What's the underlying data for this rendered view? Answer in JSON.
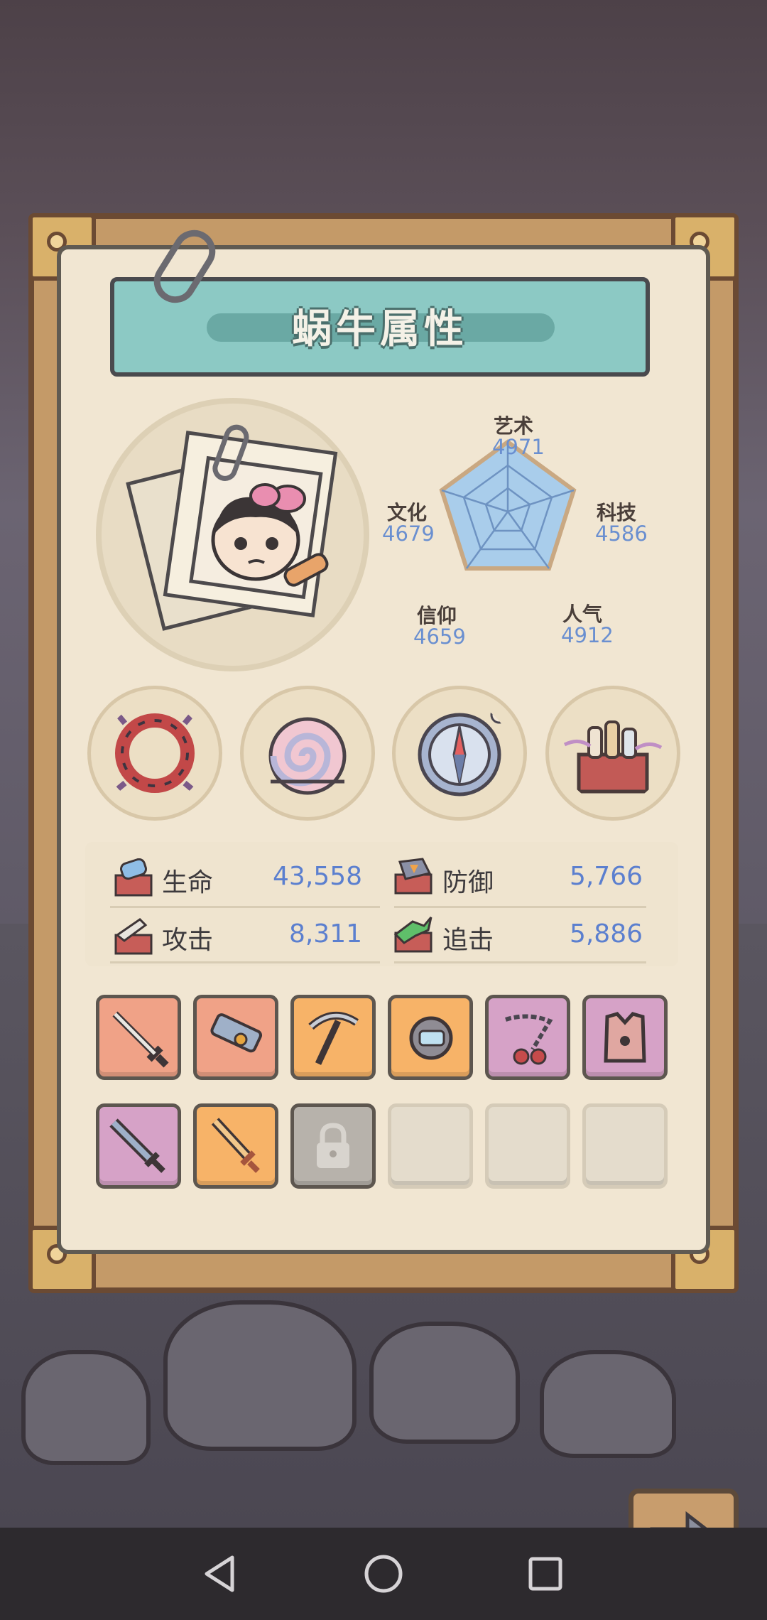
{
  "title": "蜗牛属性",
  "radar": {
    "stats": [
      {
        "name": "艺术",
        "value": "4971"
      },
      {
        "name": "科技",
        "value": "4586"
      },
      {
        "name": "人气",
        "value": "4912"
      },
      {
        "name": "信仰",
        "value": "4659"
      },
      {
        "name": "文化",
        "value": "4679"
      }
    ]
  },
  "attributes": [
    {
      "label": "生命",
      "value": "43,558"
    },
    {
      "label": "防御",
      "value": "5,766"
    },
    {
      "label": "攻击",
      "value": "8,311"
    },
    {
      "label": "追击",
      "value": "5,886"
    }
  ],
  "medals": [
    "thorn-relic-icon",
    "snail-shell-icon",
    "compass-icon",
    "bottles-crate-icon"
  ],
  "equipment": [
    {
      "icon": "sword-icon",
      "color": "#f0a287"
    },
    {
      "icon": "blaster-icon",
      "color": "#f0a287"
    },
    {
      "icon": "pickaxe-icon",
      "color": "#f7b368"
    },
    {
      "icon": "gauntlet-icon",
      "color": "#f7b368"
    },
    {
      "icon": "chain-flail-icon",
      "color": "#d6a2c7"
    },
    {
      "icon": "armor-vest-icon",
      "color": "#d6a2c7"
    },
    {
      "icon": "dagger-icon",
      "color": "#d6a2c7"
    },
    {
      "icon": "short-sword-icon",
      "color": "#f7b368"
    },
    {
      "icon": "lock-icon",
      "color": "#b7b2ab"
    },
    {
      "icon": "empty-slot",
      "color": "#e4dccc"
    },
    {
      "icon": "empty-slot",
      "color": "#e4dccc"
    },
    {
      "icon": "empty-slot",
      "color": "#e4dccc"
    }
  ]
}
